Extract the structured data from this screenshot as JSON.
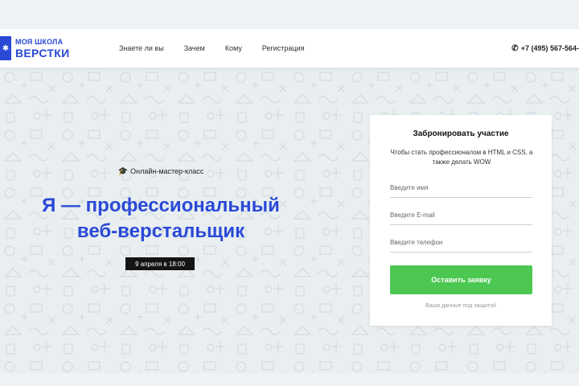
{
  "header": {
    "logo": {
      "line1": "МОЯ ШКОЛА",
      "line2": "ВЕРСТКИ",
      "icon": "star-icon"
    },
    "nav": [
      {
        "label": "Знаете ли вы"
      },
      {
        "label": "Зачем"
      },
      {
        "label": "Кому"
      },
      {
        "label": "Регистрация"
      }
    ],
    "phone": "+7 (495) 567-564-"
  },
  "hero": {
    "subtitle": "Онлайн-мастер-класс",
    "subtitle_icon": "graduation-cap-icon",
    "headline_line1": "Я — профессиональный",
    "headline_line2": "веб-верстальщик",
    "date": "9 апреля в 18:00"
  },
  "form": {
    "title": "Забронировать участие",
    "description": "Чтобы стать профессионалом в HTML и CSS, а также делать WOW",
    "name_placeholder": "Введите имя",
    "email_placeholder": "Введите E-mail",
    "phone_placeholder": "Введите телефон",
    "submit_label": "Оставить заявку",
    "privacy": "Ваши данные под защитой"
  },
  "colors": {
    "brand_blue": "#2a49d6",
    "button_green": "#4cc852",
    "hero_bg": "#e9eef1",
    "badge_black": "#141414"
  }
}
